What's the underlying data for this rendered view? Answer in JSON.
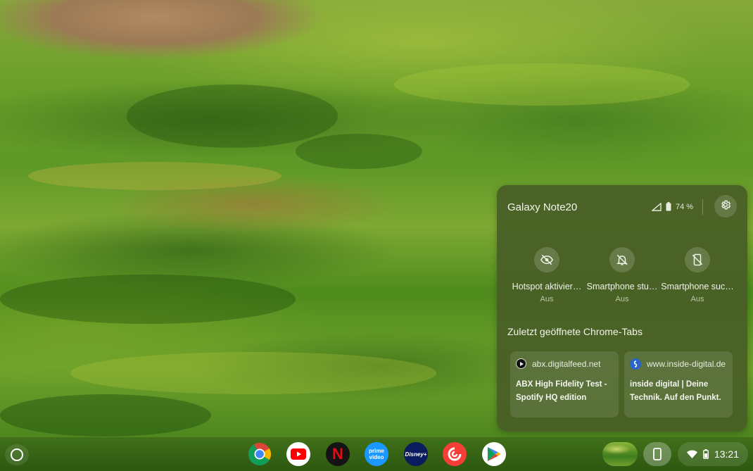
{
  "phone_hub": {
    "device_name": "Galaxy Note20",
    "battery_text": "74 %",
    "quick_settings": [
      {
        "label": "Hotspot aktivier…",
        "state": "Aus"
      },
      {
        "label": "Smartphone stu…",
        "state": "Aus"
      },
      {
        "label": "Smartphone suc…",
        "state": "Aus"
      }
    ],
    "recent_tabs_heading": "Zuletzt geöffnete Chrome-Tabs",
    "tabs": [
      {
        "site": "abx.digitalfeed.net",
        "title": "ABX High Fidelity Test - Spotify HQ edition"
      },
      {
        "site": "www.inside-digital.de",
        "title": "inside digital | Deine Technik. Auf den Punkt."
      }
    ]
  },
  "shelf": {
    "apps": [
      {
        "name": "chrome",
        "icon": "chrome-icon"
      },
      {
        "name": "youtube",
        "icon": "youtube-icon"
      },
      {
        "name": "netflix",
        "icon": "netflix-icon",
        "text": "N"
      },
      {
        "name": "prime-video",
        "icon": "prime-video-icon",
        "text": "prime video"
      },
      {
        "name": "disney-plus",
        "icon": "disney-plus-icon",
        "text": "Disney+"
      },
      {
        "name": "pocket-casts",
        "icon": "pocket-casts-icon"
      },
      {
        "name": "play-store",
        "icon": "play-store-icon"
      }
    ],
    "clock": "13:21"
  },
  "colors": {
    "hub_bg": "#485e26",
    "chrome_red": "#db4437",
    "chrome_yellow": "#f4b400",
    "chrome_green": "#0f9d58",
    "chrome_blue": "#4285f4",
    "youtube_red": "#ff0000",
    "netflix_red": "#e50914",
    "prime_blue": "#1a98ff",
    "disney_navy": "#0b1b5e",
    "pocketcasts_red": "#f43e37"
  }
}
